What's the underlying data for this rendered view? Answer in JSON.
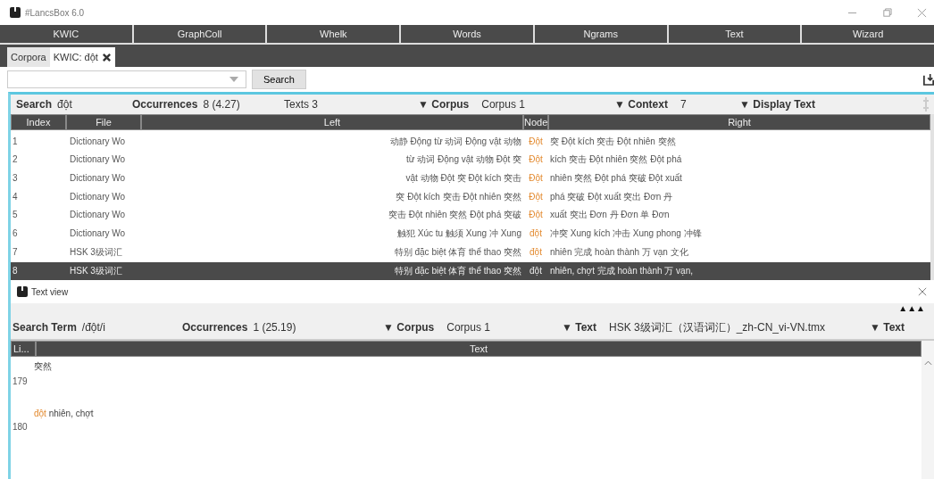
{
  "window": {
    "title": "#LancsBox 6.0"
  },
  "tools": [
    {
      "label": "KWIC"
    },
    {
      "label": "GraphColl"
    },
    {
      "label": "Whelk"
    },
    {
      "label": "Words"
    },
    {
      "label": "Ngrams"
    },
    {
      "label": "Text"
    },
    {
      "label": "Wizard"
    }
  ],
  "doc_tabs": [
    {
      "label": "Corpora",
      "selected": false,
      "closable": false
    },
    {
      "label": "KWIC: đột",
      "selected": true,
      "closable": true
    }
  ],
  "search": {
    "button": "Search"
  },
  "stats": [
    {
      "kind": "pair",
      "label": "Search",
      "value": "đột"
    },
    {
      "kind": "pair",
      "label": "Occurrences",
      "value": "8 (4.27)"
    },
    {
      "kind": "plain",
      "label": "Texts",
      "value": "3"
    },
    {
      "kind": "drop",
      "label": "▼ Corpus",
      "value": "Corpus 1"
    },
    {
      "kind": "drop",
      "label": "▼ Context",
      "value": "7"
    },
    {
      "kind": "drop",
      "label": "▼ Display Text"
    }
  ],
  "table": {
    "columns": [
      "Index",
      "File",
      "Left",
      "Node",
      "Right"
    ],
    "rows": [
      {
        "index": "1",
        "file": "Dictionary Wo",
        "left": "动静 Động từ 动词 Động vật 动物",
        "node": "Đột",
        "right": "突 Đột kích 突击 Đột nhiên 突然",
        "selected": false
      },
      {
        "index": "2",
        "file": "Dictionary Wo",
        "left": "từ 动词 Động vật 动物 Đột 突",
        "node": "Đột",
        "right": "kích 突击 Đột nhiên 突然 Đột phá",
        "selected": false
      },
      {
        "index": "3",
        "file": "Dictionary Wo",
        "left": "vật 动物 Đột 突 Đột kích 突击",
        "node": "Đột",
        "right": "nhiên 突然 Đột phá 突破 Đột xuất",
        "selected": false
      },
      {
        "index": "4",
        "file": "Dictionary Wo",
        "left": "突 Đột kích 突击 Đột nhiên 突然",
        "node": "Đột",
        "right": "phá 突破 Đột xuất 突出 Đơn 丹",
        "selected": false
      },
      {
        "index": "5",
        "file": "Dictionary Wo",
        "left": "突击 Đột nhiên 突然 Đột phá 突破",
        "node": "Đột",
        "right": "xuất 突出 Đơn 丹 Đơn 单 Đơn",
        "selected": false
      },
      {
        "index": "6",
        "file": "Dictionary Wo",
        "left": "触犯 Xúc tu 触须 Xung 冲 Xung",
        "node": "đột",
        "right": "冲突 Xung kích 冲击 Xung phong 冲锋",
        "selected": false
      },
      {
        "index": "7",
        "file": "HSK 3级词汇",
        "left": "特别 đặc biệt 体育 thể thao 突然",
        "node": "đột",
        "right": "nhiên 完成 hoàn thành 万 vạn 文化",
        "selected": false
      },
      {
        "index": "8",
        "file": "HSK 3级词汇",
        "left": "特别 đặc biệt 体育 thể thao 突然",
        "node": "đột",
        "right": "nhiên, chợt 完成 hoàn thành 万 vạn,",
        "selected": true
      }
    ]
  },
  "text_view": {
    "title": "Text view",
    "collapse": "▲▲▲",
    "stats": [
      {
        "kind": "pair",
        "label": "Search Term",
        "value": "/đột/i"
      },
      {
        "kind": "pair",
        "label": "Occurrences",
        "value": "1 (25.19)"
      },
      {
        "kind": "drop",
        "label": "▼ Corpus",
        "value": "Corpus 1"
      },
      {
        "kind": "drop",
        "label": "▼ Text",
        "value": "HSK 3级词汇（汉语词汇）_zh-CN_vi-VN.tmx"
      },
      {
        "kind": "drop",
        "label": "▼ Text"
      }
    ],
    "columns": [
      "Li...",
      "Text"
    ],
    "lines": [
      {
        "number": "179",
        "text": "突然"
      },
      {
        "number": "180",
        "hit": "đột",
        "text": " nhiên, chợt"
      }
    ]
  }
}
